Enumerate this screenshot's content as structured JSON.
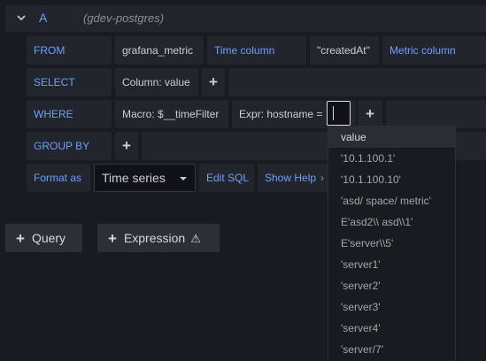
{
  "query": {
    "ref_id": "A",
    "datasource": "(gdev-postgres)"
  },
  "from_row": {
    "keyword": "FROM",
    "table": "grafana_metric",
    "time_column_label": "Time column",
    "time_column_value": "\"createdAt\"",
    "metric_column_label": "Metric column"
  },
  "select_row": {
    "keyword": "SELECT",
    "column": "Column: value",
    "add": "+"
  },
  "where_row": {
    "keyword": "WHERE",
    "macro": "Macro: $__timeFilter",
    "expr": "Expr: hostname =",
    "add": "+"
  },
  "groupby_row": {
    "keyword": "GROUP BY",
    "add": "+"
  },
  "format_row": {
    "label": "Format as",
    "selected": "Time series",
    "edit_sql": "Edit SQL",
    "show_help": "Show Help",
    "show_help_arrow": "›"
  },
  "suggestions": [
    "value",
    "'10.1.100.1'",
    "'10.1.100.10'",
    "'asd/ space/ metric'",
    "E'asd2\\\\ asd\\\\1'",
    "E'server\\\\5'",
    "'server1'",
    "'server2'",
    "'server3'",
    "'server4'",
    "'server/7'"
  ],
  "buttons": {
    "query": "Query",
    "expression": "Expression",
    "plus": "+",
    "warning_glyph": "⚠"
  },
  "colors": {
    "background": "#181b1f",
    "segment": "#22252b",
    "keyword": "#6e9fff",
    "text": "#ccccdc"
  }
}
